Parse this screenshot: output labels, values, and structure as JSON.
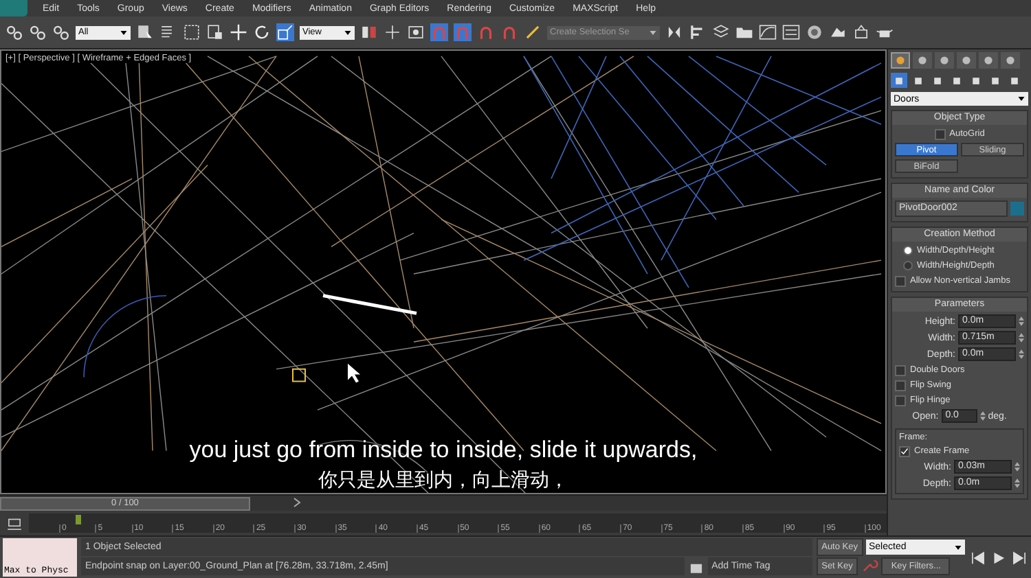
{
  "menu_bar": {
    "items": [
      "Edit",
      "Tools",
      "Group",
      "Views",
      "Create",
      "Modifiers",
      "Animation",
      "Graph Editors",
      "Rendering",
      "Customize",
      "MAXScript",
      "Help"
    ]
  },
  "toolbar": {
    "selection_filter": "All",
    "reference_coordinate_system": "View",
    "named_selection_set": "Create Selection Se",
    "snap_toggles": [
      {
        "selected": true
      },
      {
        "selected": true
      },
      {
        "selected": false
      },
      {
        "selected": false
      }
    ]
  },
  "viewport": {
    "label": "[+] [ Perspective ] [ Wireframe + Edged Faces ]",
    "subtitles": [
      "you just go from inside to inside, slide it upwards,",
      "你只是从里到内，向上滑动，"
    ]
  },
  "command_panel": {
    "tabs": [
      {
        "selected": true
      },
      {
        "selected": false
      },
      {
        "selected": false
      },
      {
        "selected": false
      },
      {
        "selected": false
      },
      {
        "selected": false
      }
    ],
    "categories": [
      {
        "selected": true
      },
      {
        "selected": false
      },
      {
        "selected": false
      },
      {
        "selected": false
      },
      {
        "selected": false
      },
      {
        "selected": false
      },
      {
        "selected": false
      }
    ],
    "object_category": "Doors",
    "object_type": {
      "title": "Object Type",
      "autogrid": {
        "label": "AutoGrid",
        "checked": false
      },
      "buttons": [
        {
          "label": "Pivot",
          "selected": true
        },
        {
          "label": "Sliding",
          "selected": false
        },
        {
          "label": "BiFold",
          "selected": false
        }
      ]
    },
    "name_and_color": {
      "title": "Name and Color",
      "name": "PivotDoor002",
      "color": "#1b6f8c"
    },
    "creation_method": {
      "title": "Creation Method",
      "options": [
        {
          "label": "Width/Depth/Height",
          "selected": true
        },
        {
          "label": "Width/Height/Depth",
          "selected": false
        }
      ],
      "allow_jambs": {
        "label": "Allow Non-vertical Jambs",
        "checked": false
      }
    },
    "parameters": {
      "title": "Parameters",
      "spinners": [
        {
          "label": "Height:",
          "value": "0.0m"
        },
        {
          "label": "Width:",
          "value": "0.715m"
        },
        {
          "label": "Depth:",
          "value": "0.0m"
        }
      ],
      "checkboxes": [
        {
          "label": "Double Doors",
          "checked": false
        },
        {
          "label": "Flip Swing",
          "checked": false
        },
        {
          "label": "Flip Hinge",
          "checked": false
        }
      ],
      "open": {
        "label": "Open:",
        "value": "0.0",
        "unit": "deg."
      },
      "frame": {
        "title": "Frame:",
        "create_frame": {
          "label": "Create Frame",
          "checked": true
        },
        "spinners": [
          {
            "label": "Width:",
            "value": "0.03m"
          },
          {
            "label": "Depth:",
            "value": "0.0m"
          }
        ]
      }
    }
  },
  "time_slider": {
    "label": "0 / 100",
    "level": 0
  },
  "track_bar": {
    "ticks": [
      "0",
      "5",
      "10",
      "15",
      "20",
      "25",
      "30",
      "35",
      "40",
      "45",
      "50",
      "55",
      "60",
      "65",
      "70",
      "75",
      "80",
      "85",
      "90",
      "95",
      "100"
    ]
  },
  "status_bar": {
    "script_listener": "Max to Physc",
    "selection_info": "1 Object Selected",
    "prompt": "Endpoint snap on Layer:00_Ground_Plan at [76.28m, 33.718m, 2.45m]",
    "add_time_tag": "Add Time Tag",
    "auto_key": {
      "label": "Auto Key",
      "selected": false
    },
    "key_mode": "Selected",
    "set_key": "Set Key",
    "key_filters": "Key Filters..."
  }
}
